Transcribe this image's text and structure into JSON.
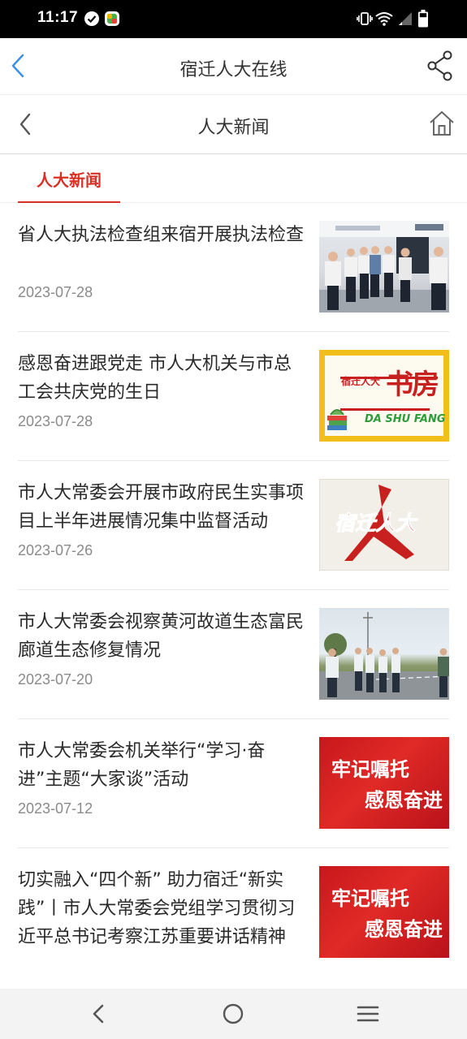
{
  "status_bar": {
    "time": "11:17",
    "icons": [
      "check-circle-icon",
      "app-notification-icon",
      "vibrate-icon",
      "wifi-icon",
      "signal-icon",
      "battery-icon"
    ]
  },
  "app_header": {
    "title": "宿迁人大在线",
    "back_icon": "chevron-left-icon",
    "share_icon": "share-icon",
    "back_color": "#3a8ee6"
  },
  "sub_header": {
    "title": "人大新闻",
    "back_icon": "chevron-left-icon",
    "home_icon": "home-icon"
  },
  "tabs": [
    {
      "label": "人大新闻",
      "active": true
    }
  ],
  "colors": {
    "accent": "#d93025",
    "date": "#8a8a8a",
    "text": "#2a2a2a"
  },
  "news": [
    {
      "title": "省人大执法检查组来宿开展执法检查",
      "date": "2023-07-28",
      "thumb": "photo-meeting"
    },
    {
      "title": "感恩奋进跟党走 市人大机关与市总工会共庆党的生日",
      "date": "2023-07-28",
      "thumb": "dashufang-logo"
    },
    {
      "title": "市人大常委会开展市政府民生实事项目上半年进展情况集中监督活动",
      "date": "2023-07-26",
      "thumb": "suqian-renda-logo"
    },
    {
      "title": "市人大常委会视察黄河故道生态富民廊道生态修复情况",
      "date": "2023-07-20",
      "thumb": "photo-field"
    },
    {
      "title": "市人大常委会机关举行“学习·奋进”主题“大家谈”活动",
      "date": "2023-07-12",
      "thumb": "red-banner"
    },
    {
      "title": "切实融入“四个新” 助力宿迁“新实践”丨市人大常委会党组学习贯彻习近平总书记考察江苏重要讲话精神",
      "date": "",
      "thumb": "red-banner"
    }
  ],
  "thumb_text": {
    "dashufang_badge": "宿迁人大",
    "dashufang_main": "书房",
    "dashufang_pinyin": "DA SHU FANG",
    "suqian_logo": "宿迁人大",
    "red_banner_line1": "牢记嘱托",
    "red_banner_line2": "感恩奋进"
  },
  "nav_bar": {
    "buttons": [
      "back-triangle-icon",
      "home-circle-icon",
      "menu-lines-icon"
    ]
  }
}
